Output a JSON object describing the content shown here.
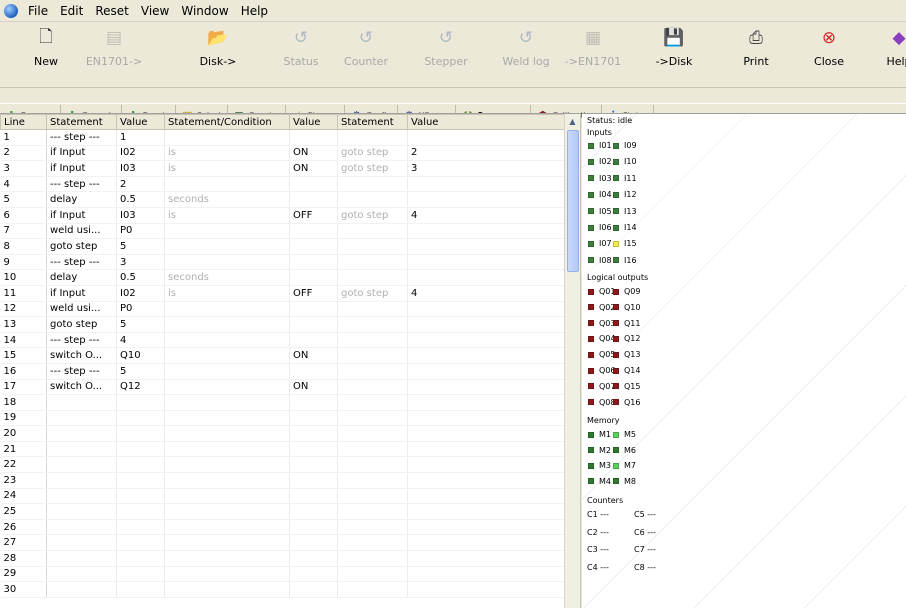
{
  "menu": [
    "File",
    "Edit",
    "Reset",
    "View",
    "Window",
    "Help"
  ],
  "toolbar": [
    {
      "label": "New",
      "icon": "new-document-icon",
      "enabled": true,
      "color": "#333333"
    },
    {
      "label": "EN1701->",
      "icon": "upload-device-icon",
      "enabled": false,
      "color": "#8a8a8a"
    },
    {
      "label": "Disk->",
      "icon": "open-folder-icon",
      "enabled": true,
      "color": "#d9a520"
    },
    {
      "label": "Status",
      "icon": "refresh-arrow-icon",
      "enabled": false,
      "color": "#6a7fb0"
    },
    {
      "label": "Counter",
      "icon": "refresh-arrow-icon",
      "enabled": false,
      "color": "#6a7fb0"
    },
    {
      "label": "Stepper",
      "icon": "refresh-arrow-icon",
      "enabled": false,
      "color": "#6a7fb0"
    },
    {
      "label": "Weld log",
      "icon": "refresh-arrow-icon",
      "enabled": false,
      "color": "#6a7fb0"
    },
    {
      "label": "->EN1701",
      "icon": "download-device-icon",
      "enabled": false,
      "color": "#8a8a8a"
    },
    {
      "label": "->Disk",
      "icon": "save-disk-icon",
      "enabled": true,
      "color": "#3a4a7a"
    },
    {
      "label": "Print",
      "icon": "printer-icon",
      "enabled": true,
      "color": "#444444"
    },
    {
      "label": "Close",
      "icon": "close-circle-icon",
      "enabled": true,
      "color": "#d8262a"
    },
    {
      "label": "Help",
      "icon": "help-icon",
      "enabled": true,
      "color": "#8a3fbf"
    }
  ],
  "tabs": [
    {
      "label": "Program",
      "icon": "plus-arrows-icon",
      "active": false
    },
    {
      "label": "Cascade",
      "icon": "plus-arrows-icon",
      "active": false
    },
    {
      "label": "Events",
      "icon": "plus-arrows-icon",
      "active": false
    },
    {
      "label": "Select",
      "icon": "select-icon",
      "active": false
    },
    {
      "label": "Counter",
      "icon": "counter-icon",
      "active": false
    },
    {
      "label": "Stepper",
      "icon": "stepper-icon",
      "active": false
    },
    {
      "label": "Config",
      "icon": "config-gear-icon",
      "active": false
    },
    {
      "label": "I/O map",
      "icon": "config-gear-icon",
      "active": false
    },
    {
      "label": "Sequencer",
      "icon": "sequencer-icon",
      "active": true
    },
    {
      "label": "Calibration",
      "icon": "calibration-icon",
      "active": false
    },
    {
      "label": "Status",
      "icon": "info-icon",
      "active": false
    }
  ],
  "table": {
    "columns": [
      "Line",
      "Statement",
      "Value",
      "Statement/Condition",
      "Value",
      "Statement",
      "Value"
    ],
    "rows": [
      [
        "1",
        "--- step ---",
        "1",
        "",
        "",
        "",
        ""
      ],
      [
        "2",
        "if Input",
        "I02",
        "is",
        "ON",
        "goto step",
        "2"
      ],
      [
        "3",
        "if Input",
        "I03",
        "is",
        "ON",
        "goto step",
        "3"
      ],
      [
        "4",
        "--- step ---",
        "2",
        "",
        "",
        "",
        ""
      ],
      [
        "5",
        "delay",
        "0.5",
        "seconds",
        "",
        "",
        ""
      ],
      [
        "6",
        "if Input",
        "I03",
        "is",
        "OFF",
        "goto step",
        "4"
      ],
      [
        "7",
        "weld usi...",
        "P0",
        "",
        "",
        "",
        ""
      ],
      [
        "8",
        "goto step",
        "5",
        "",
        "",
        "",
        ""
      ],
      [
        "9",
        "--- step ---",
        "3",
        "",
        "",
        "",
        ""
      ],
      [
        "10",
        "delay",
        "0.5",
        "seconds",
        "",
        "",
        ""
      ],
      [
        "11",
        "if Input",
        "I02",
        "is",
        "OFF",
        "goto step",
        "4"
      ],
      [
        "12",
        "weld usi...",
        "P0",
        "",
        "",
        "",
        ""
      ],
      [
        "13",
        "goto step",
        "5",
        "",
        "",
        "",
        ""
      ],
      [
        "14",
        "--- step ---",
        "4",
        "",
        "",
        "",
        ""
      ],
      [
        "15",
        "switch O...",
        "Q10",
        "",
        "ON",
        "",
        ""
      ],
      [
        "16",
        "--- step ---",
        "5",
        "",
        "",
        "",
        ""
      ],
      [
        "17",
        "switch O...",
        "Q12",
        "",
        "ON",
        "",
        ""
      ],
      [
        "18",
        "",
        "",
        "",
        "",
        "",
        ""
      ],
      [
        "19",
        "",
        "",
        "",
        "",
        "",
        ""
      ],
      [
        "20",
        "",
        "",
        "",
        "",
        "",
        ""
      ],
      [
        "21",
        "",
        "",
        "",
        "",
        "",
        ""
      ],
      [
        "22",
        "",
        "",
        "",
        "",
        "",
        ""
      ],
      [
        "23",
        "",
        "",
        "",
        "",
        "",
        ""
      ],
      [
        "24",
        "",
        "",
        "",
        "",
        "",
        ""
      ],
      [
        "25",
        "",
        "",
        "",
        "",
        "",
        ""
      ],
      [
        "26",
        "",
        "",
        "",
        "",
        "",
        ""
      ],
      [
        "27",
        "",
        "",
        "",
        "",
        "",
        ""
      ],
      [
        "28",
        "",
        "",
        "",
        "",
        "",
        ""
      ],
      [
        "29",
        "",
        "",
        "",
        "",
        "",
        ""
      ],
      [
        "30",
        "",
        "",
        "",
        "",
        "",
        ""
      ]
    ]
  },
  "status": {
    "title": "Status: idle",
    "inputs_label": "Inputs",
    "inputs": [
      {
        "name": "I01",
        "color": "#3c7f3c"
      },
      {
        "name": "I09",
        "color": "#3c7f3c"
      },
      {
        "name": "I02",
        "color": "#3c7f3c"
      },
      {
        "name": "I10",
        "color": "#3c7f3c"
      },
      {
        "name": "I03",
        "color": "#3c7f3c"
      },
      {
        "name": "I11",
        "color": "#3c7f3c"
      },
      {
        "name": "I04",
        "color": "#3c7f3c"
      },
      {
        "name": "I12",
        "color": "#3c7f3c"
      },
      {
        "name": "I05",
        "color": "#3c7f3c"
      },
      {
        "name": "I13",
        "color": "#3c7f3c"
      },
      {
        "name": "I06",
        "color": "#3c7f3c"
      },
      {
        "name": "I14",
        "color": "#3c7f3c"
      },
      {
        "name": "I07",
        "color": "#3c7f3c"
      },
      {
        "name": "I15",
        "color": "#f2ee4a"
      },
      {
        "name": "I08",
        "color": "#3c7f3c"
      },
      {
        "name": "I16",
        "color": "#3c7f3c"
      }
    ],
    "outputs_label": "Logical outputs",
    "outputs": [
      {
        "name": "Q01",
        "color": "#8b1a1a"
      },
      {
        "name": "Q09",
        "color": "#8b1a1a"
      },
      {
        "name": "Q02",
        "color": "#8b1a1a"
      },
      {
        "name": "Q10",
        "color": "#8b1a1a"
      },
      {
        "name": "Q03",
        "color": "#8b1a1a"
      },
      {
        "name": "Q11",
        "color": "#8b1a1a"
      },
      {
        "name": "Q04",
        "color": "#8b1a1a"
      },
      {
        "name": "Q12",
        "color": "#8b1a1a"
      },
      {
        "name": "Q05",
        "color": "#8b1a1a"
      },
      {
        "name": "Q13",
        "color": "#8b1a1a"
      },
      {
        "name": "Q06",
        "color": "#8b1a1a"
      },
      {
        "name": "Q14",
        "color": "#8b1a1a"
      },
      {
        "name": "Q07",
        "color": "#8b1a1a"
      },
      {
        "name": "Q15",
        "color": "#8b1a1a"
      },
      {
        "name": "Q08",
        "color": "#8b1a1a"
      },
      {
        "name": "Q16",
        "color": "#8b1a1a"
      }
    ],
    "memory_label": "Memory",
    "memory": [
      {
        "name": "M1",
        "color": "#2f7a2f"
      },
      {
        "name": "M5",
        "color": "#5ad35a"
      },
      {
        "name": "M2",
        "color": "#2f7a2f"
      },
      {
        "name": "M6",
        "color": "#2f7a2f"
      },
      {
        "name": "M3",
        "color": "#2f7a2f"
      },
      {
        "name": "M7",
        "color": "#5ad35a"
      },
      {
        "name": "M4",
        "color": "#2f7a2f"
      },
      {
        "name": "M8",
        "color": "#2f7a2f"
      }
    ],
    "counters_label": "Counters",
    "counters": [
      "C1 ---",
      "C5 ---",
      "C2 ---",
      "C6 ---",
      "C3 ---",
      "C7 ---",
      "C4 ---",
      "C8 ---"
    ]
  }
}
